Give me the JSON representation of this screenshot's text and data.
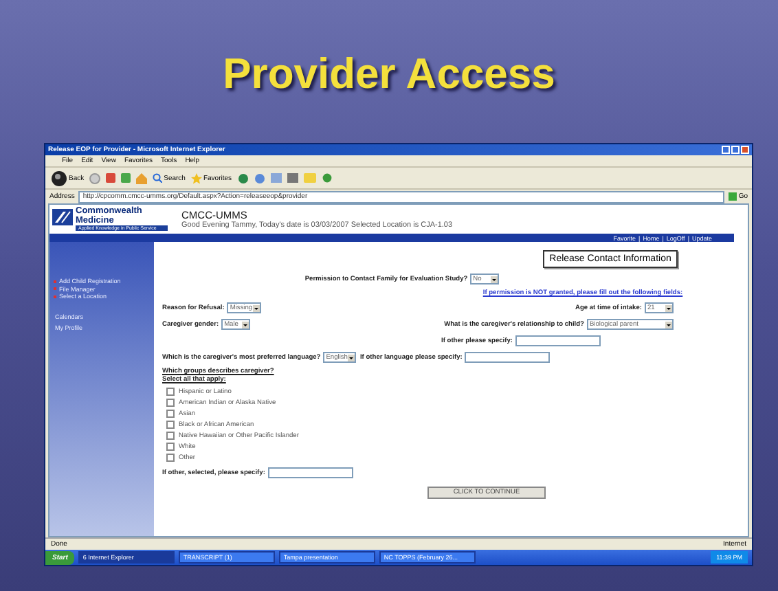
{
  "slide": {
    "title": "Provider Access"
  },
  "window": {
    "title": "Release EOP for Provider - Microsoft Internet Explorer"
  },
  "menu": [
    "File",
    "Edit",
    "View",
    "Favorites",
    "Tools",
    "Help"
  ],
  "toolbar": {
    "back": "Back",
    "search": "Search",
    "favorites": "Favorites"
  },
  "address": {
    "label": "Address",
    "url": "http://cpcomm.cmcc-umms.org/Default.aspx?Action=releaseeop&provider",
    "go": "Go"
  },
  "site": {
    "logo_line1": "Commonwealth",
    "logo_line2": "Medicine",
    "logo_tagline": "Applied Knowledge in Public Service",
    "name": "CMCC-UMMS",
    "greeting": "Good Evening Tammy, Today's date is 03/03/2007 Selected Location is CJA-1.03",
    "nav": [
      "Favorite",
      "Home",
      "LogOff",
      "Update"
    ],
    "nav_separator": "|"
  },
  "sidebar": {
    "links": [
      "Add Child Registration",
      "File Manager",
      "Select a Location"
    ],
    "items": [
      "Calendars",
      "My Profile"
    ]
  },
  "form": {
    "heading": "Release Contact Information",
    "lines": [
      {
        "kind": "center",
        "groups": [
          {
            "label": "Permission to Contact Family for Evaluation Study?",
            "control": {
              "kind": "select",
              "value": "No"
            }
          }
        ]
      },
      {
        "kind": "note",
        "text": "If permission is NOT granted, please fill out the following fields:"
      },
      {
        "kind": "split",
        "groups": [
          {
            "label": "Reason for Refusal:",
            "control": {
              "kind": "select",
              "value": "Missing"
            }
          },
          {
            "label": "Age at time of intake:",
            "control": {
              "kind": "select",
              "value": "21"
            }
          }
        ]
      },
      {
        "kind": "split",
        "groups": [
          {
            "label": "Caregiver gender:",
            "control": {
              "kind": "select",
              "value": "Male"
            }
          },
          {
            "label": "What is the caregiver's relationship to child?",
            "control": {
              "kind": "select",
              "value": "Biological parent"
            }
          }
        ]
      },
      {
        "kind": "right",
        "groups": [
          {
            "label": "If other please specify:",
            "control": {
              "kind": "input"
            }
          }
        ]
      },
      {
        "kind": "left",
        "groups": [
          {
            "label": "Which is the caregiver's most preferred language?",
            "control": {
              "kind": "select",
              "value": "English"
            }
          },
          {
            "label": "If other language please specify:",
            "control": {
              "kind": "input"
            }
          }
        ]
      }
    ],
    "groups_question": "Which groups describes caregiver?",
    "groups_hint": "Select all that apply:",
    "options": [
      {
        "label": "Hispanic or Latino",
        "checked": false
      },
      {
        "label": "American Indian or Alaska Native",
        "checked": false
      },
      {
        "label": "Asian",
        "checked": false
      },
      {
        "label": "Black or African American",
        "checked": false
      },
      {
        "label": "Native Hawaiian or Other Pacific Islander",
        "checked": false
      },
      {
        "label": "White",
        "checked": false
      },
      {
        "label": "Other",
        "checked": false
      }
    ],
    "other_label": "If other, selected, please specify:",
    "submit": "CLICK TO CONTINUE"
  },
  "status_bar": {
    "left": "Done",
    "zone": "Internet"
  },
  "taskbar": {
    "start": "Start",
    "tasks": [
      "6 Internet Explorer",
      "TRANSCRIPT (1)",
      "Tampa presentation",
      "NC TOPPS (February 26..."
    ],
    "clock": "11:39 PM"
  }
}
